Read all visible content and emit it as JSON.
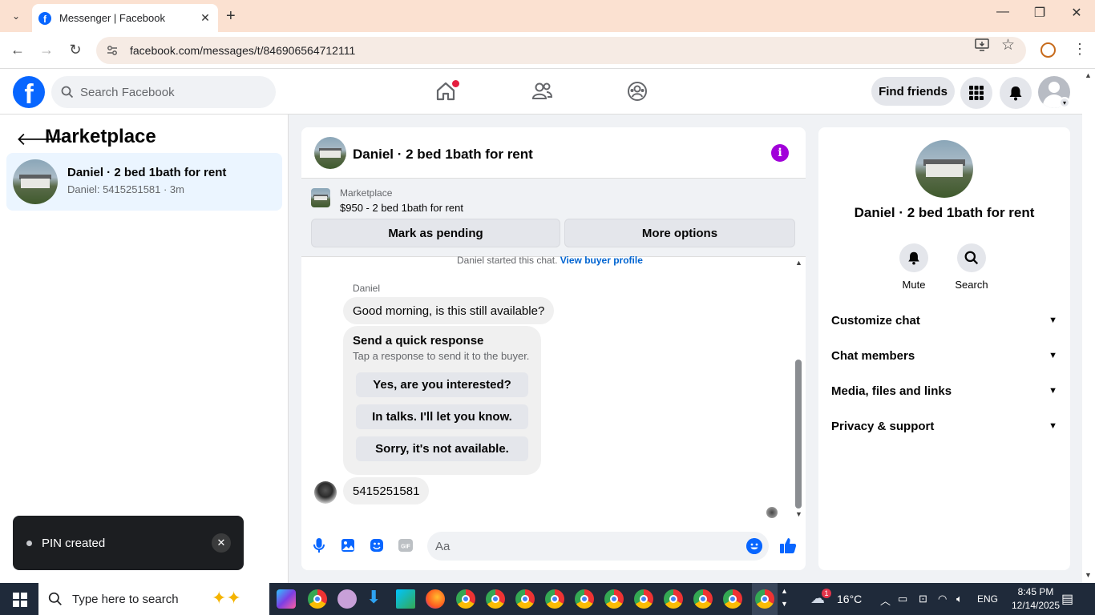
{
  "browser": {
    "tab_title": "Messenger | Facebook",
    "url": "facebook.com/messages/t/846906564712111"
  },
  "fb": {
    "search_placeholder": "Search Facebook",
    "find_friends": "Find friends"
  },
  "left": {
    "title": "Marketplace",
    "conversation": {
      "name": "Daniel · 2 bed 1bath for rent",
      "subtitle": "Daniel: 5415251581 · 3m"
    }
  },
  "chat": {
    "title": "Daniel · 2 bed 1bath for rent",
    "marketplace_label": "Marketplace",
    "listing": "$950 - 2 bed 1bath for rent",
    "mark_pending": "Mark as pending",
    "more_options": "More options",
    "started_text": "Daniel started this chat.",
    "view_profile": "View buyer profile",
    "sender": "Daniel",
    "message1": "Good morning, is this still available?",
    "quick": {
      "title": "Send a quick response",
      "subtitle": "Tap a response to send it to the buyer.",
      "options": [
        "Yes, are you interested?",
        "In talks. I'll let you know.",
        "Sorry, it's not available."
      ]
    },
    "message2": "5415251581",
    "composer_placeholder": "Aa"
  },
  "info": {
    "name": "Daniel · 2 bed 1bath for rent",
    "mute": "Mute",
    "search": "Search",
    "sections": [
      "Customize chat",
      "Chat members",
      "Media, files and links",
      "Privacy & support"
    ]
  },
  "toast": {
    "text": "PIN created"
  },
  "taskbar": {
    "search_placeholder": "Type here to search",
    "weather": "16°C",
    "weather_badge": "1",
    "language": "ENG",
    "time": "8:45 PM",
    "date": "12/14/2025"
  },
  "colors": {
    "fb_blue": "#0866ff",
    "messenger_purple": "#a100d9",
    "selected_row": "#ebf5ff",
    "tab_strip": "#fbe1d1"
  }
}
